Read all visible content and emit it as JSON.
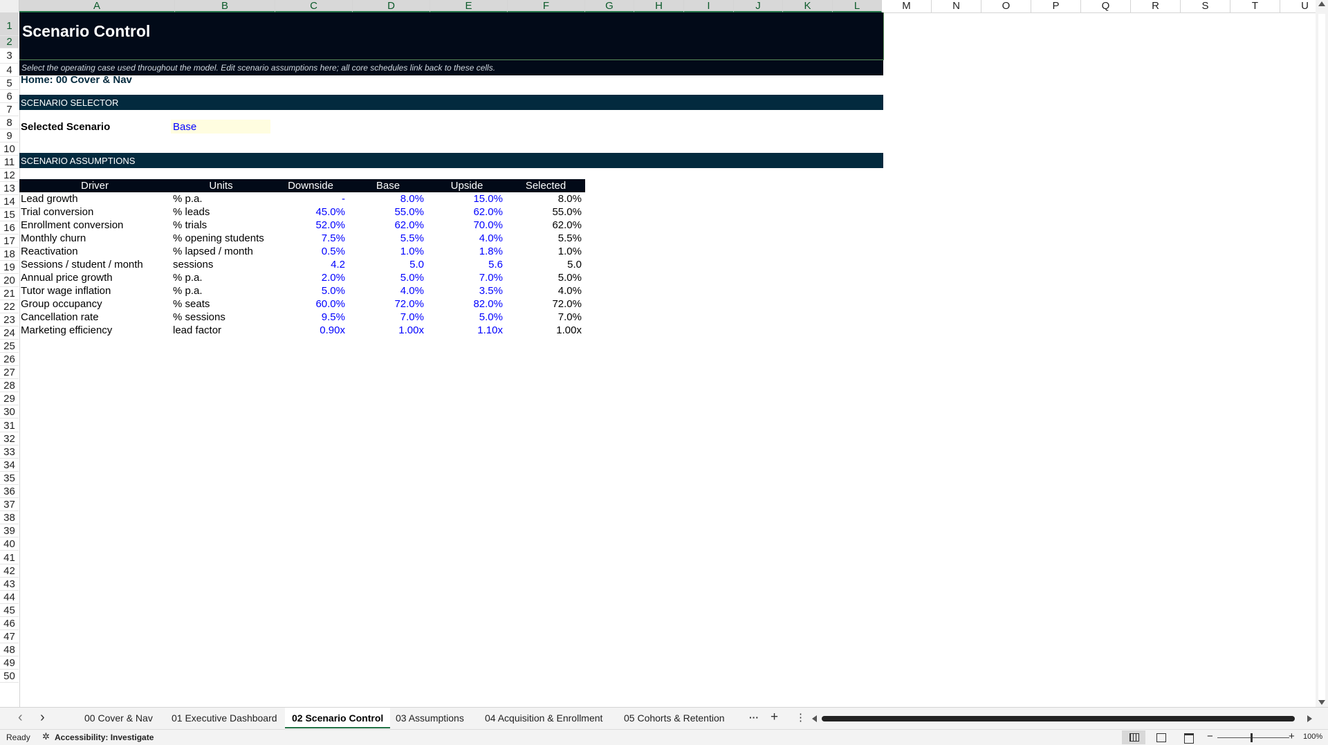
{
  "columns": [
    "A",
    "B",
    "C",
    "D",
    "E",
    "F",
    "G",
    "H",
    "I",
    "J",
    "K",
    "L",
    "M",
    "N",
    "O",
    "P",
    "Q",
    "R",
    "S",
    "T",
    "U"
  ],
  "rows": [
    "1",
    "2",
    "3",
    "4",
    "5",
    "6",
    "7",
    "8",
    "9",
    "10",
    "11",
    "12",
    "13",
    "14",
    "15",
    "16",
    "17",
    "18",
    "19",
    "20",
    "21",
    "22",
    "23",
    "24",
    "25",
    "26",
    "27",
    "28",
    "29",
    "30",
    "31",
    "32",
    "33",
    "34",
    "35",
    "36",
    "37",
    "38",
    "39",
    "40",
    "41",
    "42",
    "43",
    "44",
    "45",
    "46",
    "47",
    "48",
    "49",
    "50"
  ],
  "sheet": {
    "title": "Scenario Control",
    "subtitle": "Select the operating case used throughout the model. Edit scenario assumptions here; all core schedules link back to these cells.",
    "home_link": "Home: 00 Cover & Nav",
    "section_selector": "SCENARIO SELECTOR",
    "selected_label": "Selected Scenario",
    "selected_value": "Base",
    "section_assumptions": "SCENARIO ASSUMPTIONS",
    "table_headers": [
      "Driver",
      "Units",
      "Downside",
      "Base",
      "Upside",
      "Selected"
    ],
    "table_rows": [
      {
        "driver": "Lead growth",
        "units": "% p.a.",
        "downside": "-",
        "base": "8.0%",
        "upside": "15.0%",
        "selected": "8.0%"
      },
      {
        "driver": "Trial conversion",
        "units": "% leads",
        "downside": "45.0%",
        "base": "55.0%",
        "upside": "62.0%",
        "selected": "55.0%"
      },
      {
        "driver": "Enrollment conversion",
        "units": "% trials",
        "downside": "52.0%",
        "base": "62.0%",
        "upside": "70.0%",
        "selected": "62.0%"
      },
      {
        "driver": "Monthly churn",
        "units": "% opening students",
        "downside": "7.5%",
        "base": "5.5%",
        "upside": "4.0%",
        "selected": "5.5%"
      },
      {
        "driver": "Reactivation",
        "units": "% lapsed / month",
        "downside": "0.5%",
        "base": "1.0%",
        "upside": "1.8%",
        "selected": "1.0%"
      },
      {
        "driver": "Sessions / student / month",
        "units": "sessions",
        "downside": "4.2",
        "base": "5.0",
        "upside": "5.6",
        "selected": "5.0"
      },
      {
        "driver": "Annual price growth",
        "units": "% p.a.",
        "downside": "2.0%",
        "base": "5.0%",
        "upside": "7.0%",
        "selected": "5.0%"
      },
      {
        "driver": "Tutor wage inflation",
        "units": "% p.a.",
        "downside": "5.0%",
        "base": "4.0%",
        "upside": "3.5%",
        "selected": "4.0%"
      },
      {
        "driver": "Group occupancy",
        "units": "% seats",
        "downside": "60.0%",
        "base": "72.0%",
        "upside": "82.0%",
        "selected": "72.0%"
      },
      {
        "driver": "Cancellation rate",
        "units": "% sessions",
        "downside": "9.5%",
        "base": "7.0%",
        "upside": "5.0%",
        "selected": "7.0%"
      },
      {
        "driver": "Marketing efficiency",
        "units": "lead factor",
        "downside": "0.90x",
        "base": "1.00x",
        "upside": "1.10x",
        "selected": "1.00x"
      }
    ]
  },
  "tabs": [
    "00 Cover & Nav",
    "01 Executive Dashboard",
    "02 Scenario Control",
    "03 Assumptions",
    "04 Acquisition & Enrollment",
    "05 Cohorts & Retention"
  ],
  "active_tab": "02 Scenario Control",
  "tab_controls": {
    "more": "···",
    "add": "+",
    "menu": "⋮",
    "prev": "‹",
    "next": "›"
  },
  "status": {
    "ready": "Ready",
    "accessibility": "Accessibility: Investigate",
    "zoom": "100%"
  },
  "colors": {
    "title_band": "#020a18",
    "section_band": "#032a3e",
    "input_fill": "#fffde0",
    "input_text": "#0000ff",
    "accent": "#217346"
  },
  "icons": [
    "accessibility-icon",
    "normal-view-icon",
    "page-layout-icon",
    "page-break-icon",
    "zoom-out-icon",
    "zoom-in-icon",
    "scroll-left-icon",
    "scroll-right-icon",
    "scroll-up-icon",
    "scroll-down-icon"
  ]
}
